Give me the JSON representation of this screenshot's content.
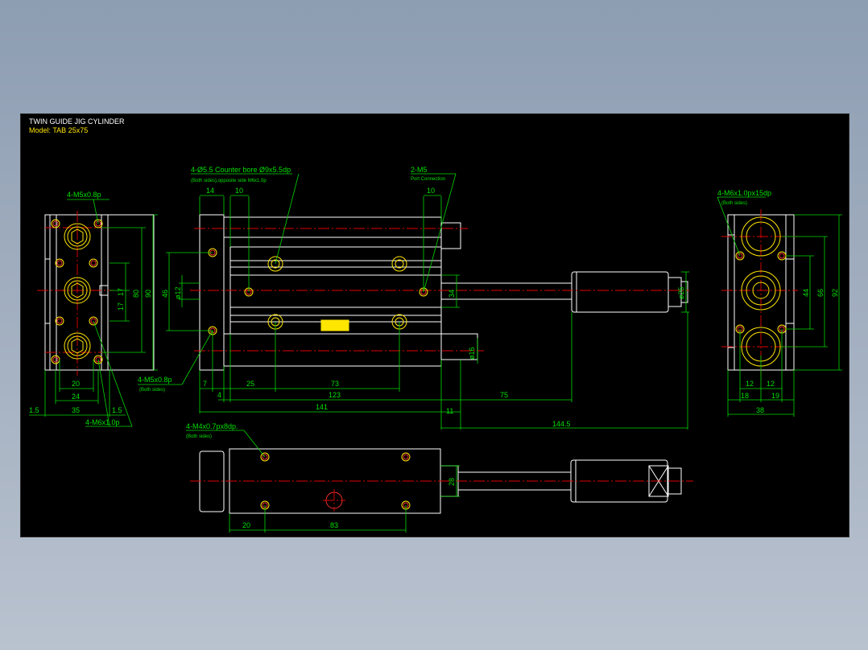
{
  "title_block": {
    "line1": "TWIN GUIDE JIG CYLINDER",
    "line2": "Model: TAB 25x75"
  },
  "colors": {
    "background": "#000000",
    "outline": "#ffffff",
    "dimension": "#00d800",
    "centerline": "#e00000",
    "hole": "#ffe600"
  },
  "callouts": {
    "left_top": "4-M5x0.8p",
    "left_mid": "4-M5x0.8p",
    "left_mid_note": "(Both sides)",
    "left_bottom": "4-M6x1.0p",
    "main_holes": "4-Ø5.5 Counter bore Ø9x5.5dp",
    "main_holes_note": "(Both sides),opposite side M6x1.0p",
    "port": "2-M5",
    "port_note": "Port Connection",
    "right_holes": "4-M6x1.0px15dp",
    "right_holes_note": "(Both sides)",
    "bottom_holes": "4-M4x0.7px8dp.",
    "bottom_holes_note": "(Both sides)"
  },
  "dims_left": {
    "d17a": "17",
    "d17b": "17",
    "d80": "80",
    "d90": "90",
    "d20": "20",
    "d24": "24",
    "d35": "35",
    "d1_5a": "1.5",
    "d1_5b": "1.5"
  },
  "dims_main": {
    "d14": "14",
    "d10a": "10",
    "d10b": "10",
    "d46": "46",
    "d12": "ø12",
    "d34": "34",
    "d16": "ø16",
    "d25": "ø25",
    "d7": "7",
    "d4": "4",
    "d25w": "25",
    "d73": "73",
    "d123": "123",
    "d141": "141",
    "d75": "75",
    "d11": "11",
    "d144_5": "144.5"
  },
  "dims_right": {
    "d44": "44",
    "d66": "66",
    "d92": "92",
    "d12a": "12",
    "d12b": "12",
    "d18": "18",
    "d19": "19",
    "d38": "38"
  },
  "dims_bottom": {
    "d28": "28",
    "d20": "20",
    "d83": "83"
  },
  "logo": "CYLINDER"
}
